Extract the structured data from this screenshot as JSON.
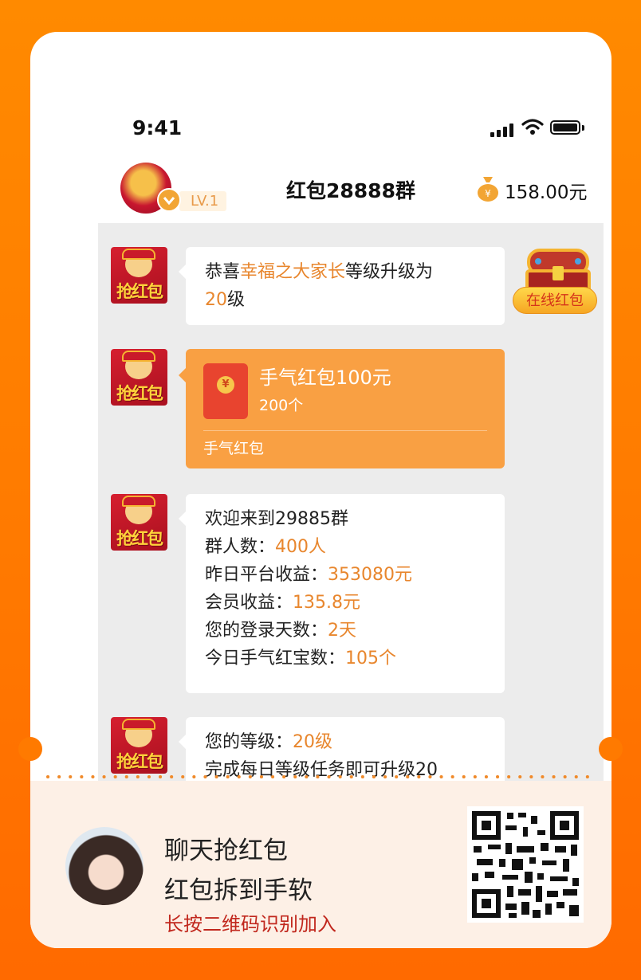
{
  "status_bar": {
    "time": "9:41"
  },
  "header": {
    "level": "LV.1",
    "title": "红包28888群",
    "balance": "158.00元"
  },
  "messages": {
    "m1": {
      "p1": "恭喜",
      "name": "幸福之大家长",
      "p2": "等级升级为",
      "level": "20",
      "p3": "级"
    },
    "red_packet": {
      "title": "手气红包100元",
      "count": "200个",
      "footer": "手气红包",
      "coin_symbol": "¥"
    },
    "m3": {
      "line1": "欢迎来到29885群",
      "l2_label": "群人数：",
      "l2_value": "400人",
      "l3_label": "昨日平台收益：",
      "l3_value": "353080元",
      "l4_label": "会员收益：",
      "l4_value": "135.8元",
      "l5_label": "您的登录天数：",
      "l5_value": "2天",
      "l6_label": "今日手气红宝数：",
      "l6_value": "105个"
    },
    "m4": {
      "l1_label": "您的等级：",
      "l1_value": "20级",
      "line2": "完成每日等级任务即可升级20"
    }
  },
  "online_button": "在线红包",
  "promo": {
    "line1": "聊天抢红包",
    "line2": "红包拆到手软",
    "line3": "长按二维码识别加入"
  },
  "colors": {
    "accent": "#ff7a00",
    "highlight": "#e8862d",
    "packet": "#f9a043",
    "promo_red": "#c1271d"
  },
  "icons": {
    "signal": "signal-icon",
    "wifi": "wifi-icon",
    "battery": "battery-icon",
    "money_bag": "money-bag-icon",
    "chest": "treasure-chest-icon",
    "qr": "qr-code"
  }
}
